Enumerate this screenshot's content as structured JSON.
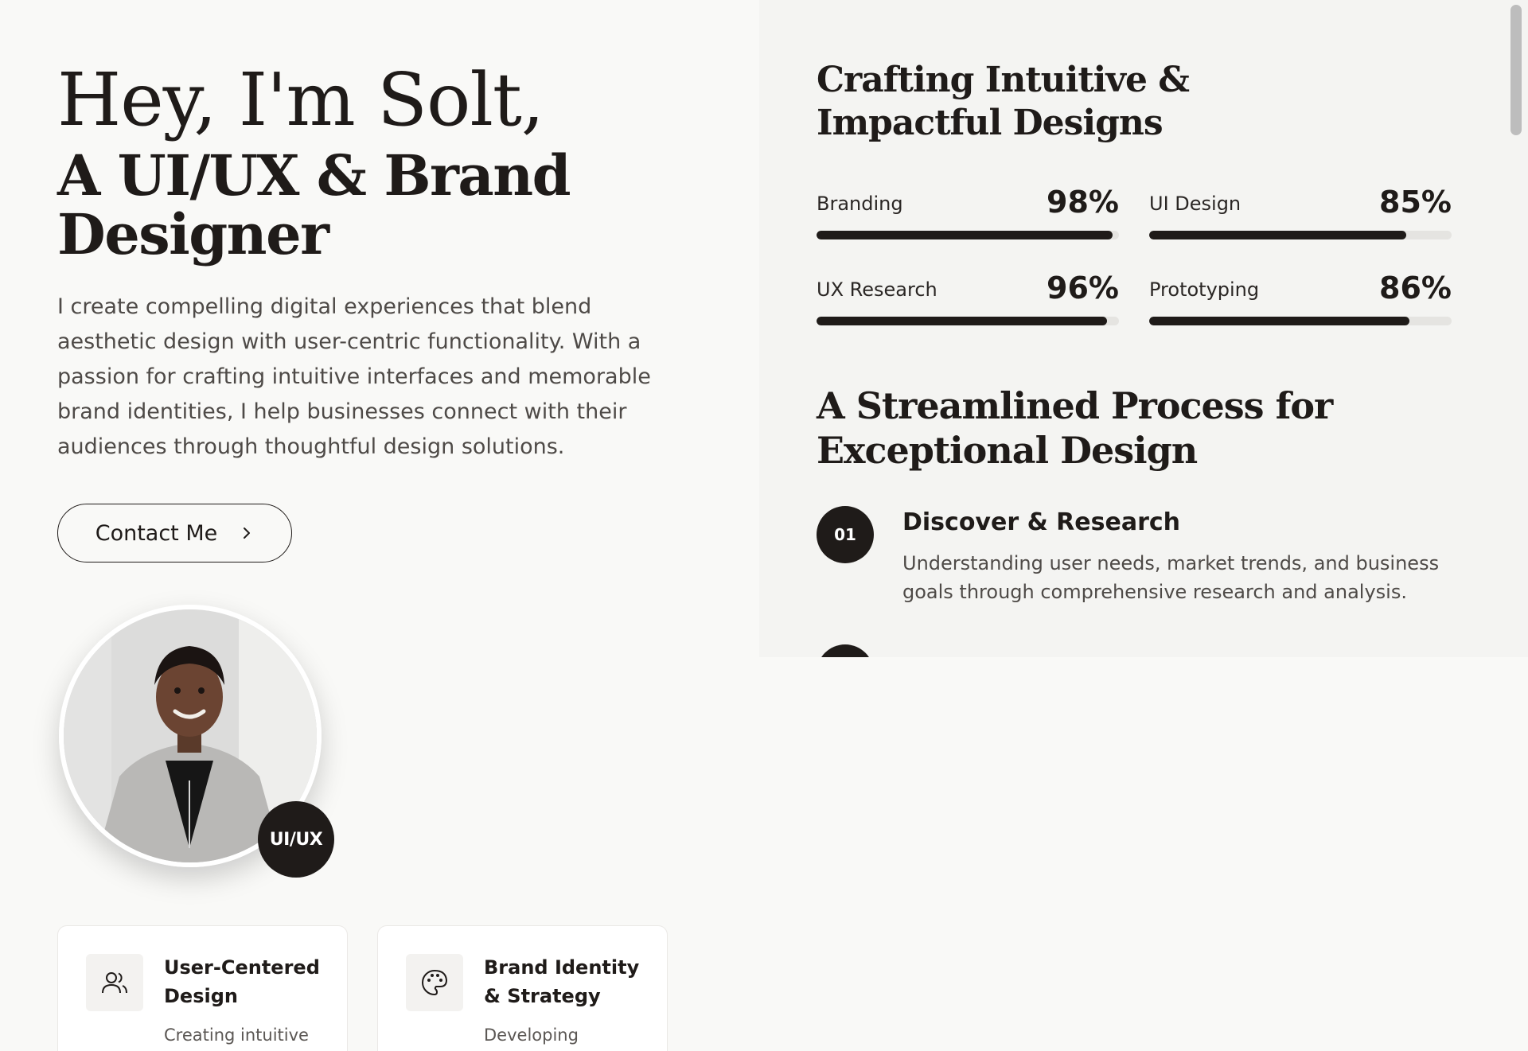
{
  "hero": {
    "greeting": "Hey, I'm Solt,",
    "role": "A UI/UX & Brand Designer",
    "bio": "I create compelling digital experiences that blend aesthetic design with user-centric functionality. With a passion for crafting intuitive interfaces and memorable brand identities, I help businesses connect with their audiences through thoughtful design solutions.",
    "contact_label": "Contact Me",
    "badge": "UI/UX"
  },
  "cards": [
    {
      "title": "User-Centered Design",
      "text": "Creating intuitive",
      "icon": "users-icon"
    },
    {
      "title": "Brand Identity & Strategy",
      "text": "Developing",
      "icon": "palette-icon"
    }
  ],
  "skills": {
    "title": "Crafting Intuitive & Impactful Designs",
    "items": [
      {
        "name": "Branding",
        "value": "98%",
        "level": 98
      },
      {
        "name": "UI Design",
        "value": "85%",
        "level": 85
      },
      {
        "name": "UX Research",
        "value": "96%",
        "level": 96
      },
      {
        "name": "Prototyping",
        "value": "86%",
        "level": 86
      }
    ]
  },
  "process": {
    "title": "A Streamlined Process for Exceptional Design",
    "steps": [
      {
        "number": "01",
        "title": "Discover & Research",
        "text": "Understanding user needs, market trends, and business goals through comprehensive research and analysis."
      }
    ]
  },
  "colors": {
    "background": "#f9f9f7",
    "panel": "#f4f4f2",
    "ink": "#1f1b19",
    "track": "#e5e4e1"
  }
}
